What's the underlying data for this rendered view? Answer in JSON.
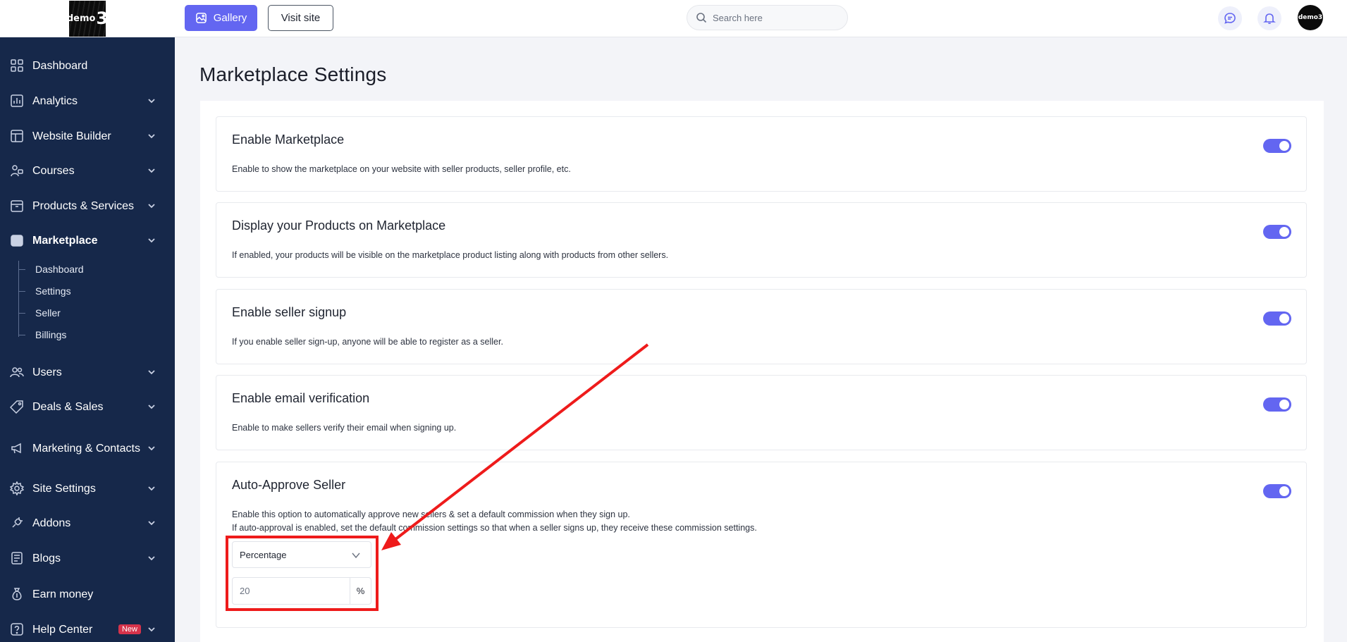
{
  "sidebar": {
    "logo_small": "demo",
    "logo_big": "3",
    "items": [
      {
        "label": "Dashboard"
      },
      {
        "label": "Analytics"
      },
      {
        "label": "Website Builder"
      },
      {
        "label": "Courses"
      },
      {
        "label": "Products & Services"
      },
      {
        "label": "Marketplace"
      },
      {
        "label": "Users"
      },
      {
        "label": "Deals & Sales"
      },
      {
        "label": "Marketing & Contacts"
      },
      {
        "label": "Site Settings"
      },
      {
        "label": "Addons"
      },
      {
        "label": "Blogs"
      },
      {
        "label": "Earn money"
      },
      {
        "label": "Help Center",
        "badge": "New"
      }
    ],
    "marketplace_sub": [
      "Dashboard",
      "Settings",
      "Seller",
      "Billings"
    ]
  },
  "topbar": {
    "gallery_label": "Gallery",
    "visit_label": "Visit site",
    "search_placeholder": "Search here",
    "avatar_text": "demo3"
  },
  "main": {
    "title": "Marketplace Settings",
    "cards": [
      {
        "title": "Enable Marketplace",
        "desc": "Enable to show the marketplace on your website with seller products, seller profile, etc.",
        "enabled": true
      },
      {
        "title": "Display your Products on Marketplace",
        "desc": "If enabled, your products will be visible on the marketplace product listing along with products from other sellers.",
        "enabled": true
      },
      {
        "title": "Enable seller signup",
        "desc": "If you enable seller sign-up, anyone will be able to register as a seller.",
        "enabled": true
      },
      {
        "title": "Enable email verification",
        "desc": "Enable to make sellers verify their email when signing up.",
        "enabled": true
      },
      {
        "title": "Auto-Approve Seller",
        "desc": "Enable this option to automatically approve new sellers & set a default commission when they sign up.",
        "desc2": "If auto-approval is enabled, set the default commission settings so that when a seller signs up, they receive these commission settings.",
        "enabled": true
      }
    ],
    "commission_type": "Percentage",
    "commission_value": "20",
    "commission_unit": "%"
  },
  "colors": {
    "sidebar_bg": "#16284a",
    "accent": "#6366f1",
    "annotation": "#ee1b1b"
  }
}
